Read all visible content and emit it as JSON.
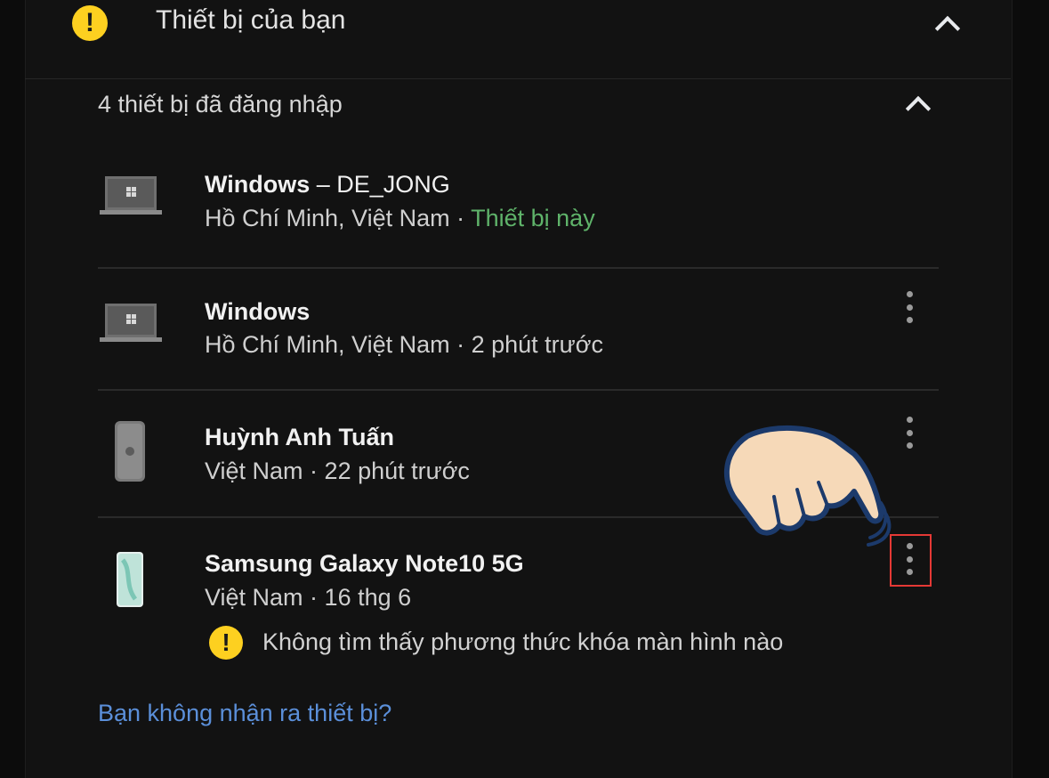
{
  "header": {
    "title": "Thiết bị của bạn",
    "warning_glyph": "!",
    "collapse_icon": "chevron-up-icon"
  },
  "devices_section": {
    "title": "4 thiết bị đã đăng nhập",
    "collapse_icon": "chevron-up-icon",
    "devices": [
      {
        "name": "Windows",
        "name_suffix": " – DE_JONG",
        "location": "Hồ Chí Minh, Việt Nam",
        "separator": " · ",
        "status": "Thiết bị này",
        "icon": "laptop-icon",
        "has_menu": false
      },
      {
        "name": "Windows",
        "location": "Hồ Chí Minh, Việt Nam",
        "separator": " · ",
        "status": "2 phút trước",
        "icon": "laptop-icon",
        "has_menu": true
      },
      {
        "name": "Huỳnh Anh Tuấn",
        "location": "Việt Nam",
        "separator": " · ",
        "status": "22 phút trước",
        "icon": "iphone-icon",
        "has_menu": true
      },
      {
        "name": "Samsung Galaxy Note10 5G",
        "location": "Việt Nam",
        "separator": " · ",
        "status": "16 thg 6",
        "icon": "android-phone-icon",
        "has_menu": true,
        "highlighted_menu": true,
        "warning": "Không tìm thấy phương thức khóa màn hình nào",
        "warning_glyph": "!"
      }
    ]
  },
  "link": {
    "label": "Bạn không nhận ra thiết bị?"
  },
  "colors": {
    "background": "#121212",
    "warning_badge": "#fdd020",
    "this_device": "#5fb36a",
    "link": "#5b8fd9",
    "highlight_box": "#e53935",
    "pointer_hand_fill": "#f6d9b8",
    "pointer_hand_outline": "#1c3a6b"
  },
  "overlay": {
    "pointer": "pointing-hand-icon"
  }
}
